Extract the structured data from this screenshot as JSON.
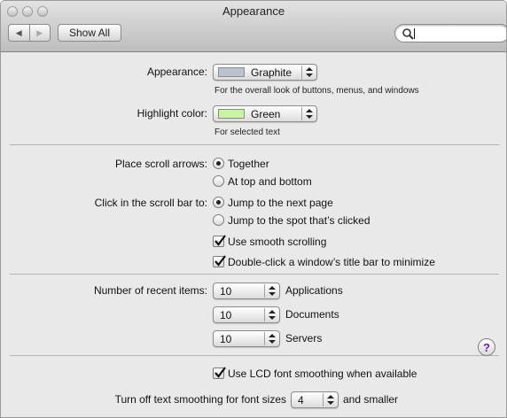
{
  "window": {
    "title": "Appearance"
  },
  "toolbar": {
    "back_glyph": "◀",
    "forward_glyph": "▶",
    "show_all_label": "Show All",
    "search": {
      "value": "",
      "placeholder": ""
    }
  },
  "appearance": {
    "label": "Appearance:",
    "value": "Graphite",
    "swatch_color": "#b9c3cf",
    "note": "For the overall look of buttons, menus, and windows"
  },
  "highlight": {
    "label": "Highlight color:",
    "value": "Green",
    "swatch_color": "#c8f5a0",
    "note": "For selected text"
  },
  "scroll_arrows": {
    "label": "Place scroll arrows:",
    "options": [
      {
        "label": "Together",
        "selected": true
      },
      {
        "label": "At top and bottom",
        "selected": false
      }
    ]
  },
  "scroll_bar_click": {
    "label": "Click in the scroll bar to:",
    "options": [
      {
        "label": "Jump to the next page",
        "selected": true
      },
      {
        "label": "Jump to the spot that’s clicked",
        "selected": false
      }
    ]
  },
  "checkboxes": {
    "smooth_scrolling": {
      "label": "Use smooth scrolling",
      "checked": true
    },
    "double_click_minimize": {
      "label": "Double-click a window’s title bar to minimize",
      "checked": true
    },
    "lcd_smoothing": {
      "label": "Use LCD font smoothing when available",
      "checked": true
    }
  },
  "recent_items": {
    "label": "Number of recent items:",
    "rows": [
      {
        "value": "10",
        "kind": "Applications"
      },
      {
        "value": "10",
        "kind": "Documents"
      },
      {
        "value": "10",
        "kind": "Servers"
      }
    ]
  },
  "text_smoothing": {
    "label": "Turn off text smoothing for font sizes",
    "value": "4",
    "suffix": "and smaller"
  },
  "help": {
    "glyph": "?"
  }
}
